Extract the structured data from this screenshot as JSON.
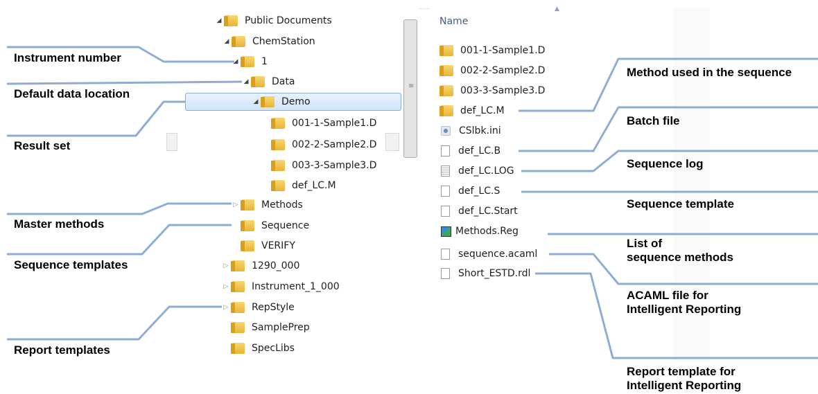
{
  "tree": {
    "items": [
      {
        "label": "Public Documents",
        "icon": "folder-icon",
        "arrow": "expanded"
      },
      {
        "label": "ChemStation",
        "icon": "folder-icon",
        "arrow": "expanded"
      },
      {
        "label": "1",
        "icon": "folder-icon",
        "arrow": "expanded"
      },
      {
        "label": "Data",
        "icon": "folder-icon",
        "arrow": "expanded"
      },
      {
        "label": "Demo",
        "icon": "folder-icon",
        "arrow": "expanded",
        "selected": true
      },
      {
        "label": "001-1-Sample1.D",
        "icon": "folder-icon",
        "arrow": "none"
      },
      {
        "label": "002-2-Sample2.D",
        "icon": "folder-icon",
        "arrow": "none"
      },
      {
        "label": "003-3-Sample3.D",
        "icon": "folder-icon",
        "arrow": "none"
      },
      {
        "label": "def_LC.M",
        "icon": "folder-icon",
        "arrow": "none"
      },
      {
        "label": "Methods",
        "icon": "folder-icon",
        "arrow": "collapsed"
      },
      {
        "label": "Sequence",
        "icon": "folder-icon",
        "arrow": "none"
      },
      {
        "label": "VERIFY",
        "icon": "folder-icon",
        "arrow": "none"
      },
      {
        "label": "1290_000",
        "icon": "folder-icon",
        "arrow": "collapsed"
      },
      {
        "label": "Instrument_1_000",
        "icon": "folder-icon",
        "arrow": "collapsed"
      },
      {
        "label": "RepStyle",
        "icon": "folder-icon",
        "arrow": "collapsed"
      },
      {
        "label": "SamplePrep",
        "icon": "folder-icon",
        "arrow": "none"
      },
      {
        "label": "SpecLibs",
        "icon": "folder-icon",
        "arrow": "none"
      }
    ]
  },
  "files": {
    "column_header": "Name",
    "items": [
      {
        "label": "001-1-Sample1.D",
        "icon": "folder-icon"
      },
      {
        "label": "002-2-Sample2.D",
        "icon": "folder-icon"
      },
      {
        "label": "003-3-Sample3.D",
        "icon": "folder-icon"
      },
      {
        "label": "def_LC.M",
        "icon": "folder-icon"
      },
      {
        "label": "CSlbk.ini",
        "icon": "settings-file-icon"
      },
      {
        "label": "def_LC.B",
        "icon": "document-icon"
      },
      {
        "label": "def_LC.LOG",
        "icon": "text-document-icon"
      },
      {
        "label": "def_LC.S",
        "icon": "document-icon"
      },
      {
        "label": "def_LC.Start",
        "icon": "document-icon"
      },
      {
        "label": "Methods.Reg",
        "icon": "registry-file-icon"
      },
      {
        "label": "sequence.acaml",
        "icon": "document-icon"
      },
      {
        "label": "Short_ESTD.rdl",
        "icon": "document-icon"
      }
    ]
  },
  "callouts": {
    "left": [
      {
        "text": "Instrument number"
      },
      {
        "text": "Default data location"
      },
      {
        "text": "Result set"
      },
      {
        "text": "Master methods"
      },
      {
        "text": "Sequence templates"
      },
      {
        "text": "Report templates"
      }
    ],
    "right": [
      {
        "text": "Method used in the sequence"
      },
      {
        "text": "Batch file"
      },
      {
        "text": "Sequence log"
      },
      {
        "text": "Sequence template"
      },
      {
        "text": "List of\nsequence methods"
      },
      {
        "text": "ACAML file for\nIntelligent Reporting"
      },
      {
        "text": "Report template for\nIntelligent Reporting"
      }
    ]
  },
  "colors": {
    "callout_line": "#8eadd6",
    "selection": "#cfe5fa"
  }
}
